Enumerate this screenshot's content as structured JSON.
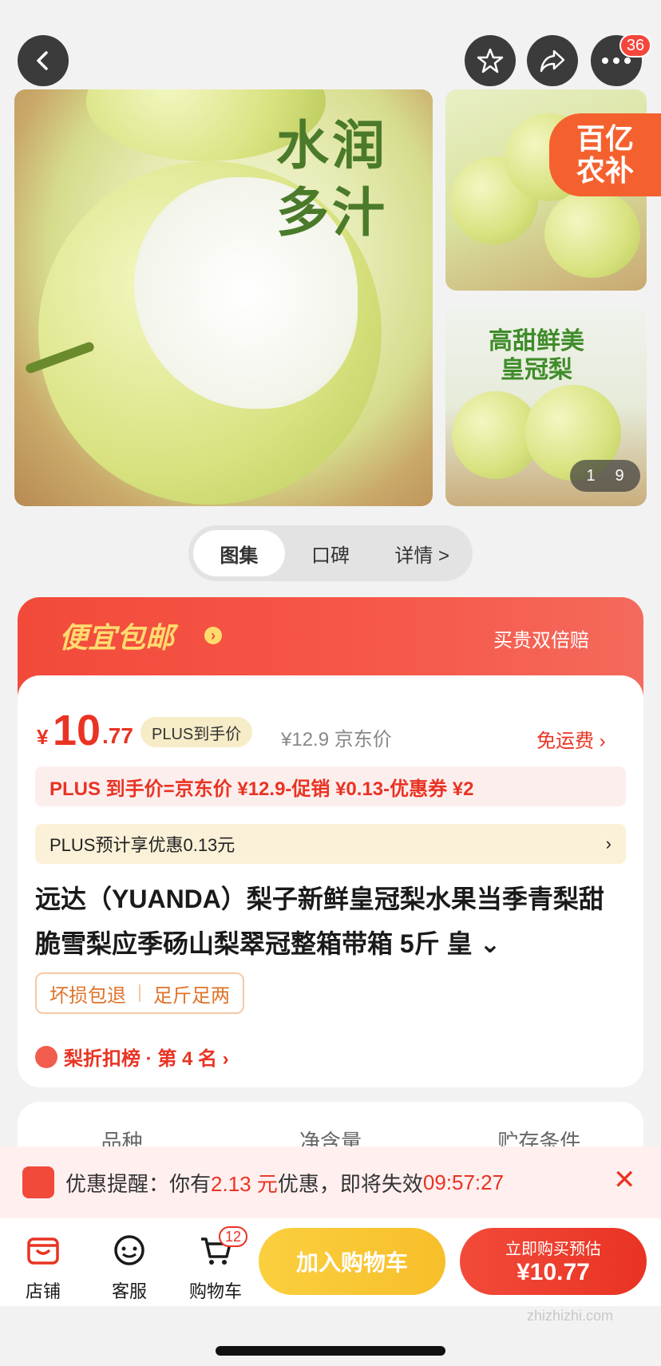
{
  "top": {
    "notification_count": "36"
  },
  "gallery": {
    "main_caption_line1": "水润",
    "main_caption_line2": "多汁",
    "stamp_line1": "百亿",
    "stamp_line2": "农补",
    "small2_caption_line1": "高甜鲜美",
    "small2_caption_line2": "皇冠梨",
    "pager_current": "1",
    "pager_total": "9"
  },
  "tabs": [
    "图集",
    "口碑",
    "详情 >"
  ],
  "promo_header": {
    "title": "便宜包邮",
    "right_text": "买贵双倍赔"
  },
  "price": {
    "currency": "¥",
    "integer": "10",
    "decimal": ".77",
    "plus_label": "PLUS到手价",
    "original": "¥12.9  京东价",
    "shipping": "免运费 ›"
  },
  "formula": "PLUS 到手价=京东价 ¥12.9-促销 ¥0.13-优惠券 ¥2",
  "plus_saving": {
    "text": "PLUS预计享优惠0.13元",
    "chevron": "›"
  },
  "product": {
    "title": "远达（YUANDA）梨子新鲜皇冠梨水果当季青梨甜脆雪梨应季砀山梨翠冠整箱带箱 5斤 皇 ⌄",
    "tags": [
      "坏损包退",
      "足斤足两"
    ],
    "rank": "梨折扣榜 · 第 4 名 ›"
  },
  "specs": [
    "品种",
    "净含量",
    "贮存条件"
  ],
  "reminder": {
    "prefix": "优惠提醒：你有",
    "amount": "2.13 元",
    "suffix": "优惠，即将失效",
    "countdown": "09:57:27",
    "close": "✕"
  },
  "bottom_nav": {
    "store": "店铺",
    "service": "客服",
    "cart": "购物车",
    "cart_count": "12",
    "add_to_cart": "加入购物车",
    "buy_line1": "立即购买预估",
    "buy_line2": "¥10.77"
  },
  "watermark": "zhizhizhi.com",
  "colors": {
    "accent_red": "#e93323",
    "cart_yellow": "#f7bf2a",
    "plus_gold": "#f6ecc7"
  }
}
